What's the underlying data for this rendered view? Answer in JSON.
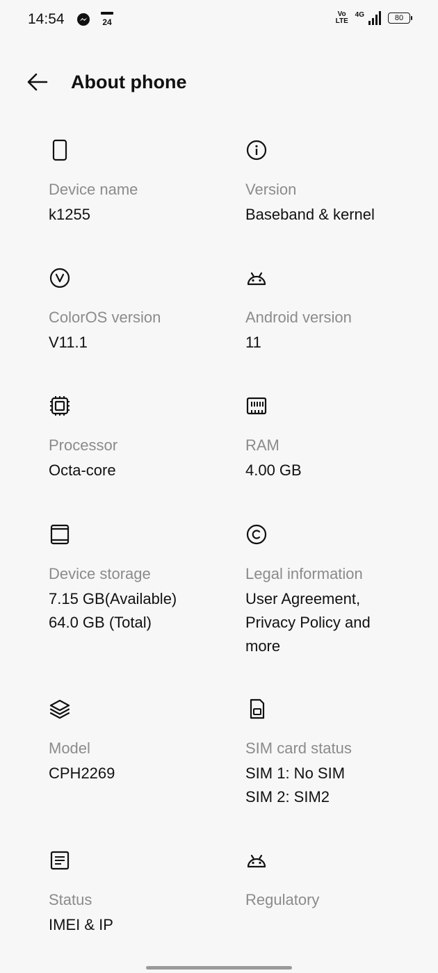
{
  "status_bar": {
    "time": "14:54",
    "app_icons": [
      "messenger-icon",
      "news-24-icon"
    ],
    "news_badge": "24",
    "volte_top": "Vo",
    "volte_bottom": "LTE",
    "network": "4G",
    "battery": "80"
  },
  "header": {
    "title": "About phone",
    "back_icon": "arrow-left-icon"
  },
  "items": [
    {
      "icon": "phone-icon",
      "label": "Device name",
      "value": "k1255"
    },
    {
      "icon": "info-icon",
      "label": "Version",
      "value": "Baseband & kernel"
    },
    {
      "icon": "coloros-icon",
      "label": "ColorOS version",
      "value": "V11.1"
    },
    {
      "icon": "android-icon",
      "label": "Android version",
      "value": "11"
    },
    {
      "icon": "processor-icon",
      "label": "Processor",
      "value": "Octa-core"
    },
    {
      "icon": "ram-icon",
      "label": "RAM",
      "value": "4.00 GB"
    },
    {
      "icon": "storage-icon",
      "label": "Device storage",
      "value_line1": "7.15 GB(Available)",
      "value_line2": "64.0 GB (Total)"
    },
    {
      "icon": "copyright-icon",
      "label": "Legal information",
      "value_line1": "User Agreement,",
      "value_line2": "Privacy Policy and",
      "value_line3": "more"
    },
    {
      "icon": "layers-icon",
      "label": "Model",
      "value": "CPH2269"
    },
    {
      "icon": "sim-card-icon",
      "label": "SIM card status",
      "value_line1": "SIM 1: No SIM",
      "value_line2": "SIM 2: SIM2"
    },
    {
      "icon": "document-icon",
      "label": "Status",
      "value": "IMEI & IP"
    },
    {
      "icon": "android-icon",
      "label": "Regulatory"
    }
  ],
  "colors": {
    "background": "#f7f7f7",
    "label": "#8b8b8b",
    "value": "#111111"
  }
}
